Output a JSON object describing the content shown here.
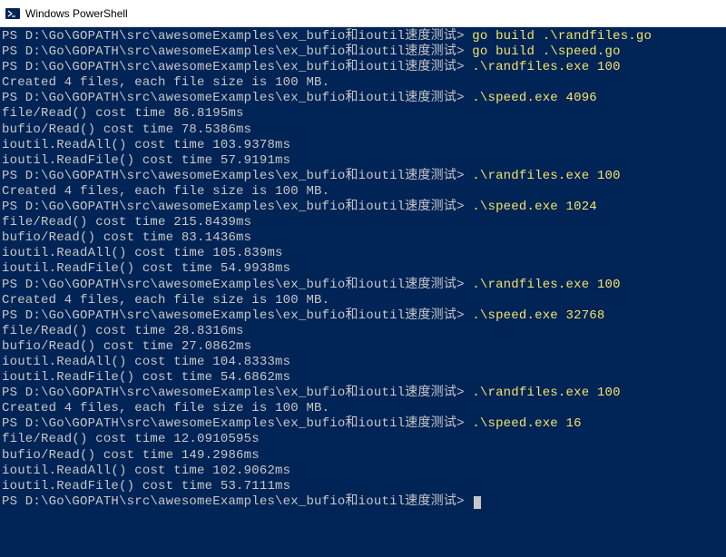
{
  "window": {
    "title": "Windows PowerShell"
  },
  "prompt_path": "PS D:\\Go\\GOPATH\\src\\awesomeExamples\\ex_bufio和ioutil速度测试> ",
  "lines": [
    {
      "type": "cmd",
      "prompt": true,
      "text": "go build .\\randfiles.go"
    },
    {
      "type": "cmd",
      "prompt": true,
      "text": "go build .\\speed.go"
    },
    {
      "type": "cmd",
      "prompt": true,
      "text": ".\\randfiles.exe 100"
    },
    {
      "type": "out",
      "text": "Created 4 files, each file size is 100 MB."
    },
    {
      "type": "cmd",
      "prompt": true,
      "text": ".\\speed.exe 4096"
    },
    {
      "type": "out",
      "text": "file/Read() cost time 86.8195ms"
    },
    {
      "type": "out",
      "text": "bufio/Read() cost time 78.5386ms"
    },
    {
      "type": "out",
      "text": "ioutil.ReadAll() cost time 103.9378ms"
    },
    {
      "type": "out",
      "text": "ioutil.ReadFile() cost time 57.9191ms"
    },
    {
      "type": "cmd",
      "prompt": true,
      "text": ".\\randfiles.exe 100"
    },
    {
      "type": "out",
      "text": "Created 4 files, each file size is 100 MB."
    },
    {
      "type": "cmd",
      "prompt": true,
      "text": ".\\speed.exe 1024"
    },
    {
      "type": "out",
      "text": "file/Read() cost time 215.8439ms"
    },
    {
      "type": "out",
      "text": "bufio/Read() cost time 83.1436ms"
    },
    {
      "type": "out",
      "text": "ioutil.ReadAll() cost time 105.839ms"
    },
    {
      "type": "out",
      "text": "ioutil.ReadFile() cost time 54.9938ms"
    },
    {
      "type": "cmd",
      "prompt": true,
      "text": ".\\randfiles.exe 100"
    },
    {
      "type": "out",
      "text": "Created 4 files, each file size is 100 MB."
    },
    {
      "type": "cmd",
      "prompt": true,
      "text": ".\\speed.exe 32768"
    },
    {
      "type": "out",
      "text": "file/Read() cost time 28.8316ms"
    },
    {
      "type": "out",
      "text": "bufio/Read() cost time 27.0862ms"
    },
    {
      "type": "out",
      "text": "ioutil.ReadAll() cost time 104.8333ms"
    },
    {
      "type": "out",
      "text": "ioutil.ReadFile() cost time 54.6862ms"
    },
    {
      "type": "cmd",
      "prompt": true,
      "text": ".\\randfiles.exe 100"
    },
    {
      "type": "out",
      "text": "Created 4 files, each file size is 100 MB."
    },
    {
      "type": "cmd",
      "prompt": true,
      "text": ".\\speed.exe 16"
    },
    {
      "type": "out",
      "text": "file/Read() cost time 12.0910595s"
    },
    {
      "type": "out",
      "text": "bufio/Read() cost time 149.2986ms"
    },
    {
      "type": "out",
      "text": "ioutil.ReadAll() cost time 102.9062ms"
    },
    {
      "type": "out",
      "text": "ioutil.ReadFile() cost time 53.7111ms"
    },
    {
      "type": "cursor",
      "prompt": true,
      "text": ""
    }
  ]
}
